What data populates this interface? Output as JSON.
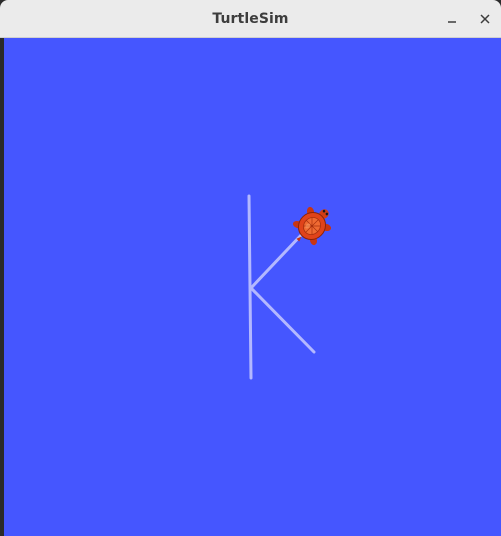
{
  "window": {
    "title": "TurtleSim",
    "buttons": {
      "minimize_icon": "minimize-icon",
      "close_icon": "close-icon"
    }
  },
  "canvas": {
    "background_color": "#4556ff",
    "pen_color": "#b3b8ff",
    "turtle": {
      "shell_color": "#e0431a",
      "icon": "turtle-icon"
    }
  }
}
